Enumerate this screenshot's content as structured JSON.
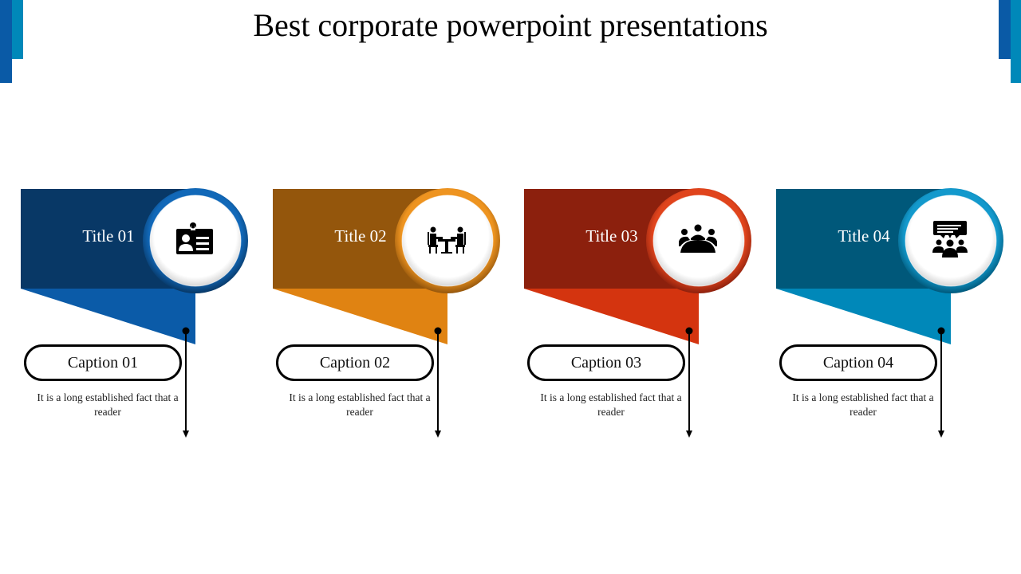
{
  "page": {
    "title": "Best corporate powerpoint presentations"
  },
  "colors": {
    "corner_dark_blue": "#0a5aa6",
    "corner_teal": "#0088b9"
  },
  "cards": [
    {
      "title": "Title 01",
      "caption": "Caption 01",
      "description": "It is a long established  fact that a reader",
      "icon": "id-badge-icon",
      "color_dark": "#083866",
      "color_light": "#0b5ba8",
      "ring_color": "#1168b8"
    },
    {
      "title": "Title 02",
      "caption": "Caption 02",
      "description": "It is a long established  fact that a reader",
      "icon": "meeting-table-icon",
      "color_dark": "#94560c",
      "color_light": "#e08312",
      "ring_color": "#ee9420"
    },
    {
      "title": "Title 03",
      "caption": "Caption 03",
      "description": "It is a long established  fact that a reader",
      "icon": "conference-group-icon",
      "color_dark": "#8c200d",
      "color_light": "#d4340f",
      "ring_color": "#e0441c"
    },
    {
      "title": "Title 04",
      "caption": "Caption 04",
      "description": "It is a long established  fact that a reader",
      "icon": "presentation-audience-icon",
      "color_dark": "#00587a",
      "color_light": "#0088b9",
      "ring_color": "#1399cc"
    }
  ]
}
